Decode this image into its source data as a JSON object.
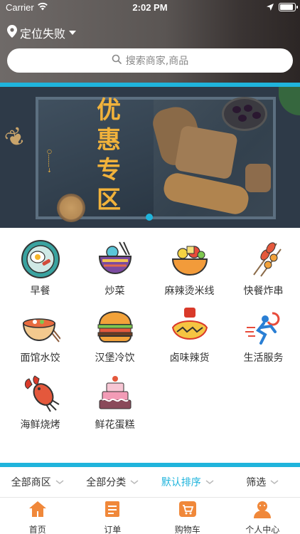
{
  "status_bar": {
    "carrier": "Carrier",
    "time": "2:02 PM"
  },
  "header": {
    "location": "定位失败",
    "search_placeholder": "搜索商家,商品"
  },
  "banner": {
    "promo_text": "优惠专区"
  },
  "categories": [
    {
      "label": "早餐",
      "icon": "breakfast-icon"
    },
    {
      "label": "炒菜",
      "icon": "stir-fry-icon"
    },
    {
      "label": "麻辣烫米线",
      "icon": "malatang-icon"
    },
    {
      "label": "快餐炸串",
      "icon": "skewer-icon"
    },
    {
      "label": "面馆水饺",
      "icon": "noodle-icon"
    },
    {
      "label": "汉堡冷饮",
      "icon": "burger-icon"
    },
    {
      "label": "卤味辣货",
      "icon": "spicy-snack-icon"
    },
    {
      "label": "生活服务",
      "icon": "runner-icon"
    },
    {
      "label": "海鲜烧烤",
      "icon": "lobster-icon"
    },
    {
      "label": "鲜花蛋糕",
      "icon": "cake-icon"
    }
  ],
  "filters": [
    {
      "label": "全部商区",
      "active": false
    },
    {
      "label": "全部分类",
      "active": false
    },
    {
      "label": "默认排序",
      "active": true
    },
    {
      "label": "筛选",
      "active": false
    }
  ],
  "tabs": [
    {
      "label": "首页",
      "icon": "home-icon"
    },
    {
      "label": "订单",
      "icon": "order-icon"
    },
    {
      "label": "购物车",
      "icon": "cart-icon"
    },
    {
      "label": "个人中心",
      "icon": "profile-icon"
    }
  ],
  "colors": {
    "accent": "#1fb4dc",
    "tab_icon": "#f0883a"
  }
}
